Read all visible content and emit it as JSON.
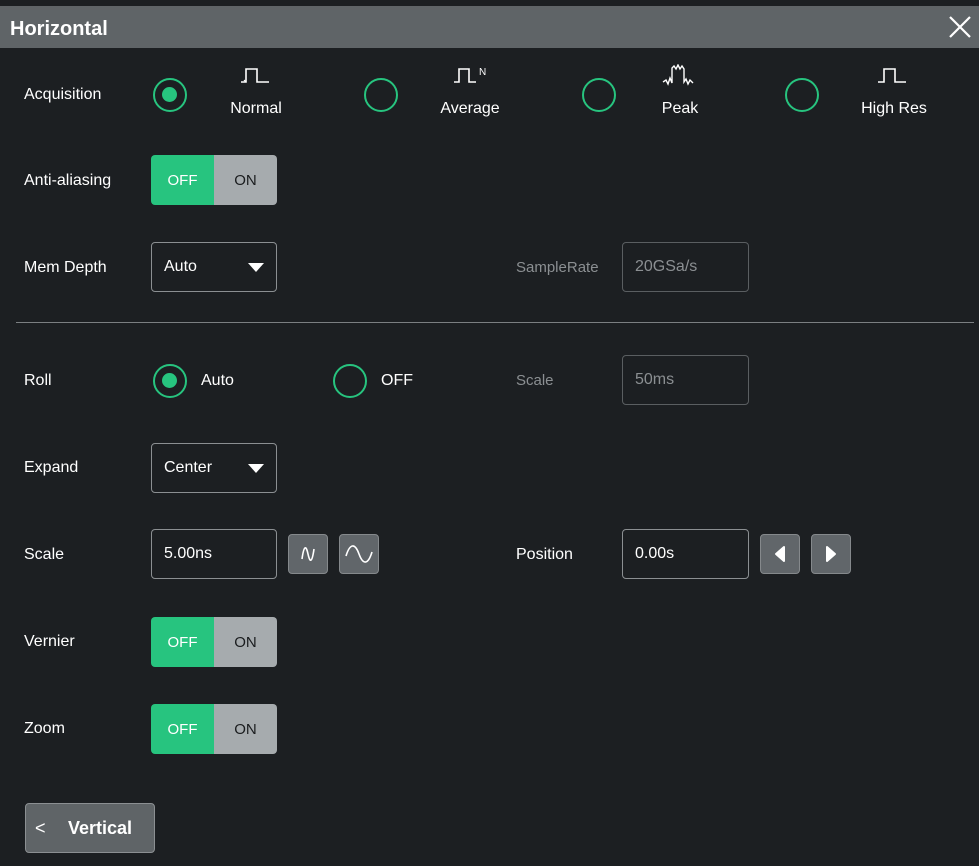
{
  "window": {
    "title": "Horizontal"
  },
  "acquisition": {
    "label": "Acquisition",
    "modes": [
      {
        "label": "Normal",
        "icon": "normal-wave-icon",
        "selected": true
      },
      {
        "label": "Average",
        "icon": "average-wave-icon",
        "icon_text": "N",
        "selected": false
      },
      {
        "label": "Peak",
        "icon": "peak-wave-icon",
        "selected": false
      },
      {
        "label": "High Res",
        "icon": "highres-wave-icon",
        "selected": false
      }
    ]
  },
  "anti_aliasing": {
    "label": "Anti-aliasing",
    "off": "OFF",
    "on": "ON",
    "value": "OFF"
  },
  "mem_depth": {
    "label": "Mem Depth",
    "value": "Auto"
  },
  "sample_rate": {
    "label": "SampleRate",
    "value": "20GSa/s"
  },
  "roll": {
    "label": "Roll",
    "options": [
      {
        "label": "Auto",
        "selected": true
      },
      {
        "label": "OFF",
        "selected": false
      }
    ],
    "scale_label": "Scale",
    "scale_value": "50ms"
  },
  "expand": {
    "label": "Expand",
    "value": "Center"
  },
  "scale": {
    "label": "Scale",
    "value": "5.00ns"
  },
  "position": {
    "label": "Position",
    "value": "0.00s"
  },
  "vernier": {
    "label": "Vernier",
    "off": "OFF",
    "on": "ON",
    "value": "OFF"
  },
  "zoom": {
    "label": "Zoom",
    "off": "OFF",
    "on": "ON",
    "value": "OFF"
  },
  "nav": {
    "vertical_label": "Vertical",
    "back_glyph": "<"
  },
  "colors": {
    "accent": "#27c47f",
    "titlebar": "#5f6467",
    "background": "#1c1f22"
  }
}
